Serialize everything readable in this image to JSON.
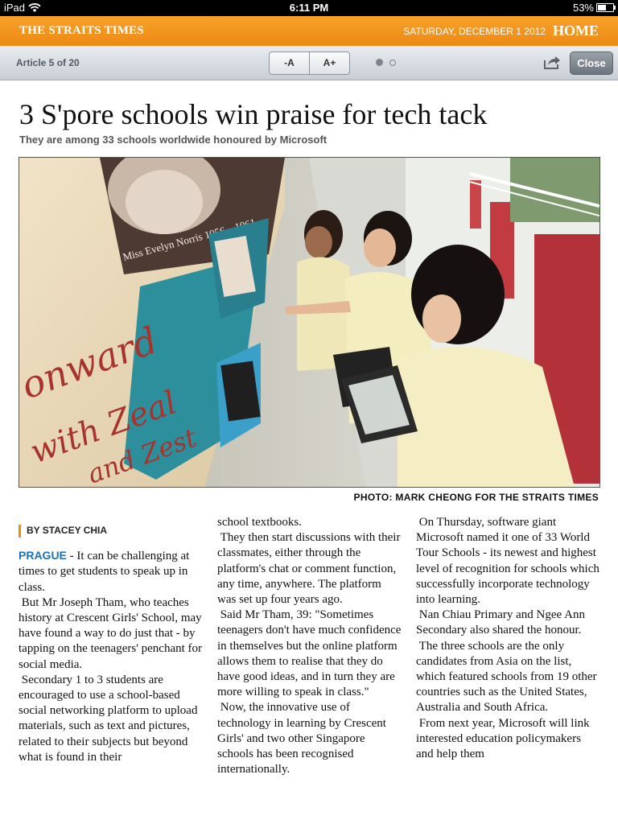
{
  "status_bar": {
    "device": "iPad",
    "time": "6:11 PM",
    "battery": "53%",
    "battery_level": 0.53
  },
  "masthead": {
    "brand": "THE STRAITS TIMES",
    "date": "SATURDAY, DECEMBER 1 2012",
    "home_label": "HOME",
    "accent_color": "#ef8a16"
  },
  "toolbar": {
    "article_counter": "Article 5 of 20",
    "font_decrease": "-A",
    "font_increase": "A+",
    "page_dots": 2,
    "active_dot": 1,
    "close_label": "Close"
  },
  "article": {
    "headline": "3 S'pore schools win praise for tech tack",
    "subheadline": "They are among 33 schools worldwide honoured by Microsoft",
    "photo_credit": "PHOTO: MARK CHEONG FOR THE STRAITS TIMES",
    "photo_caption_text": [
      "Miss Evelyn Norris 1956 – 1961",
      "onward",
      "with Zeal",
      "and Zest"
    ],
    "byline": "BY STACEY CHIA",
    "dateline": "PRAGUE",
    "col1": {
      "p1_rest": " - It can be challenging at times to get students to speak up in class.",
      "p2": "But Mr Joseph Tham, who teaches history at Crescent Girls' School, may have found a way to do just that - by tapping on the teenagers' penchant for social media.",
      "p3": "Secondary 1 to 3 students are encouraged to use a school-based social networking platform to upload materials, such as text and pictures, related to their subjects but beyond what is found in their"
    },
    "col2": {
      "p1": "school textbooks.",
      "p2": "They then start discussions with their classmates, either through the platform's chat or comment function, any time, anywhere. The platform was set up four years ago.",
      "p3": "Said Mr Tham, 39: \"Sometimes teenagers don't have much confidence in themselves but the online platform allows them to realise that they do have good ideas, and in turn they are more willing to speak in class.\"",
      "p4": "Now, the innovative use of technology in learning by Crescent Girls' and two other Singapore schools has been recognised internationally."
    },
    "col3": {
      "p1": "On Thursday, software giant Microsoft named it one of 33 World Tour Schools - its newest and highest level of recognition for schools which successfully incorporate technology into learning.",
      "p2": "Nan Chiau Primary and Ngee Ann Secondary also shared the honour.",
      "p3": "The three schools are the only candidates from Asia on the list, which featured schools from 19 other countries such as the United States, Australia and South Africa.",
      "p4": "From next year, Microsoft will link interested education policymakers and help them"
    }
  }
}
